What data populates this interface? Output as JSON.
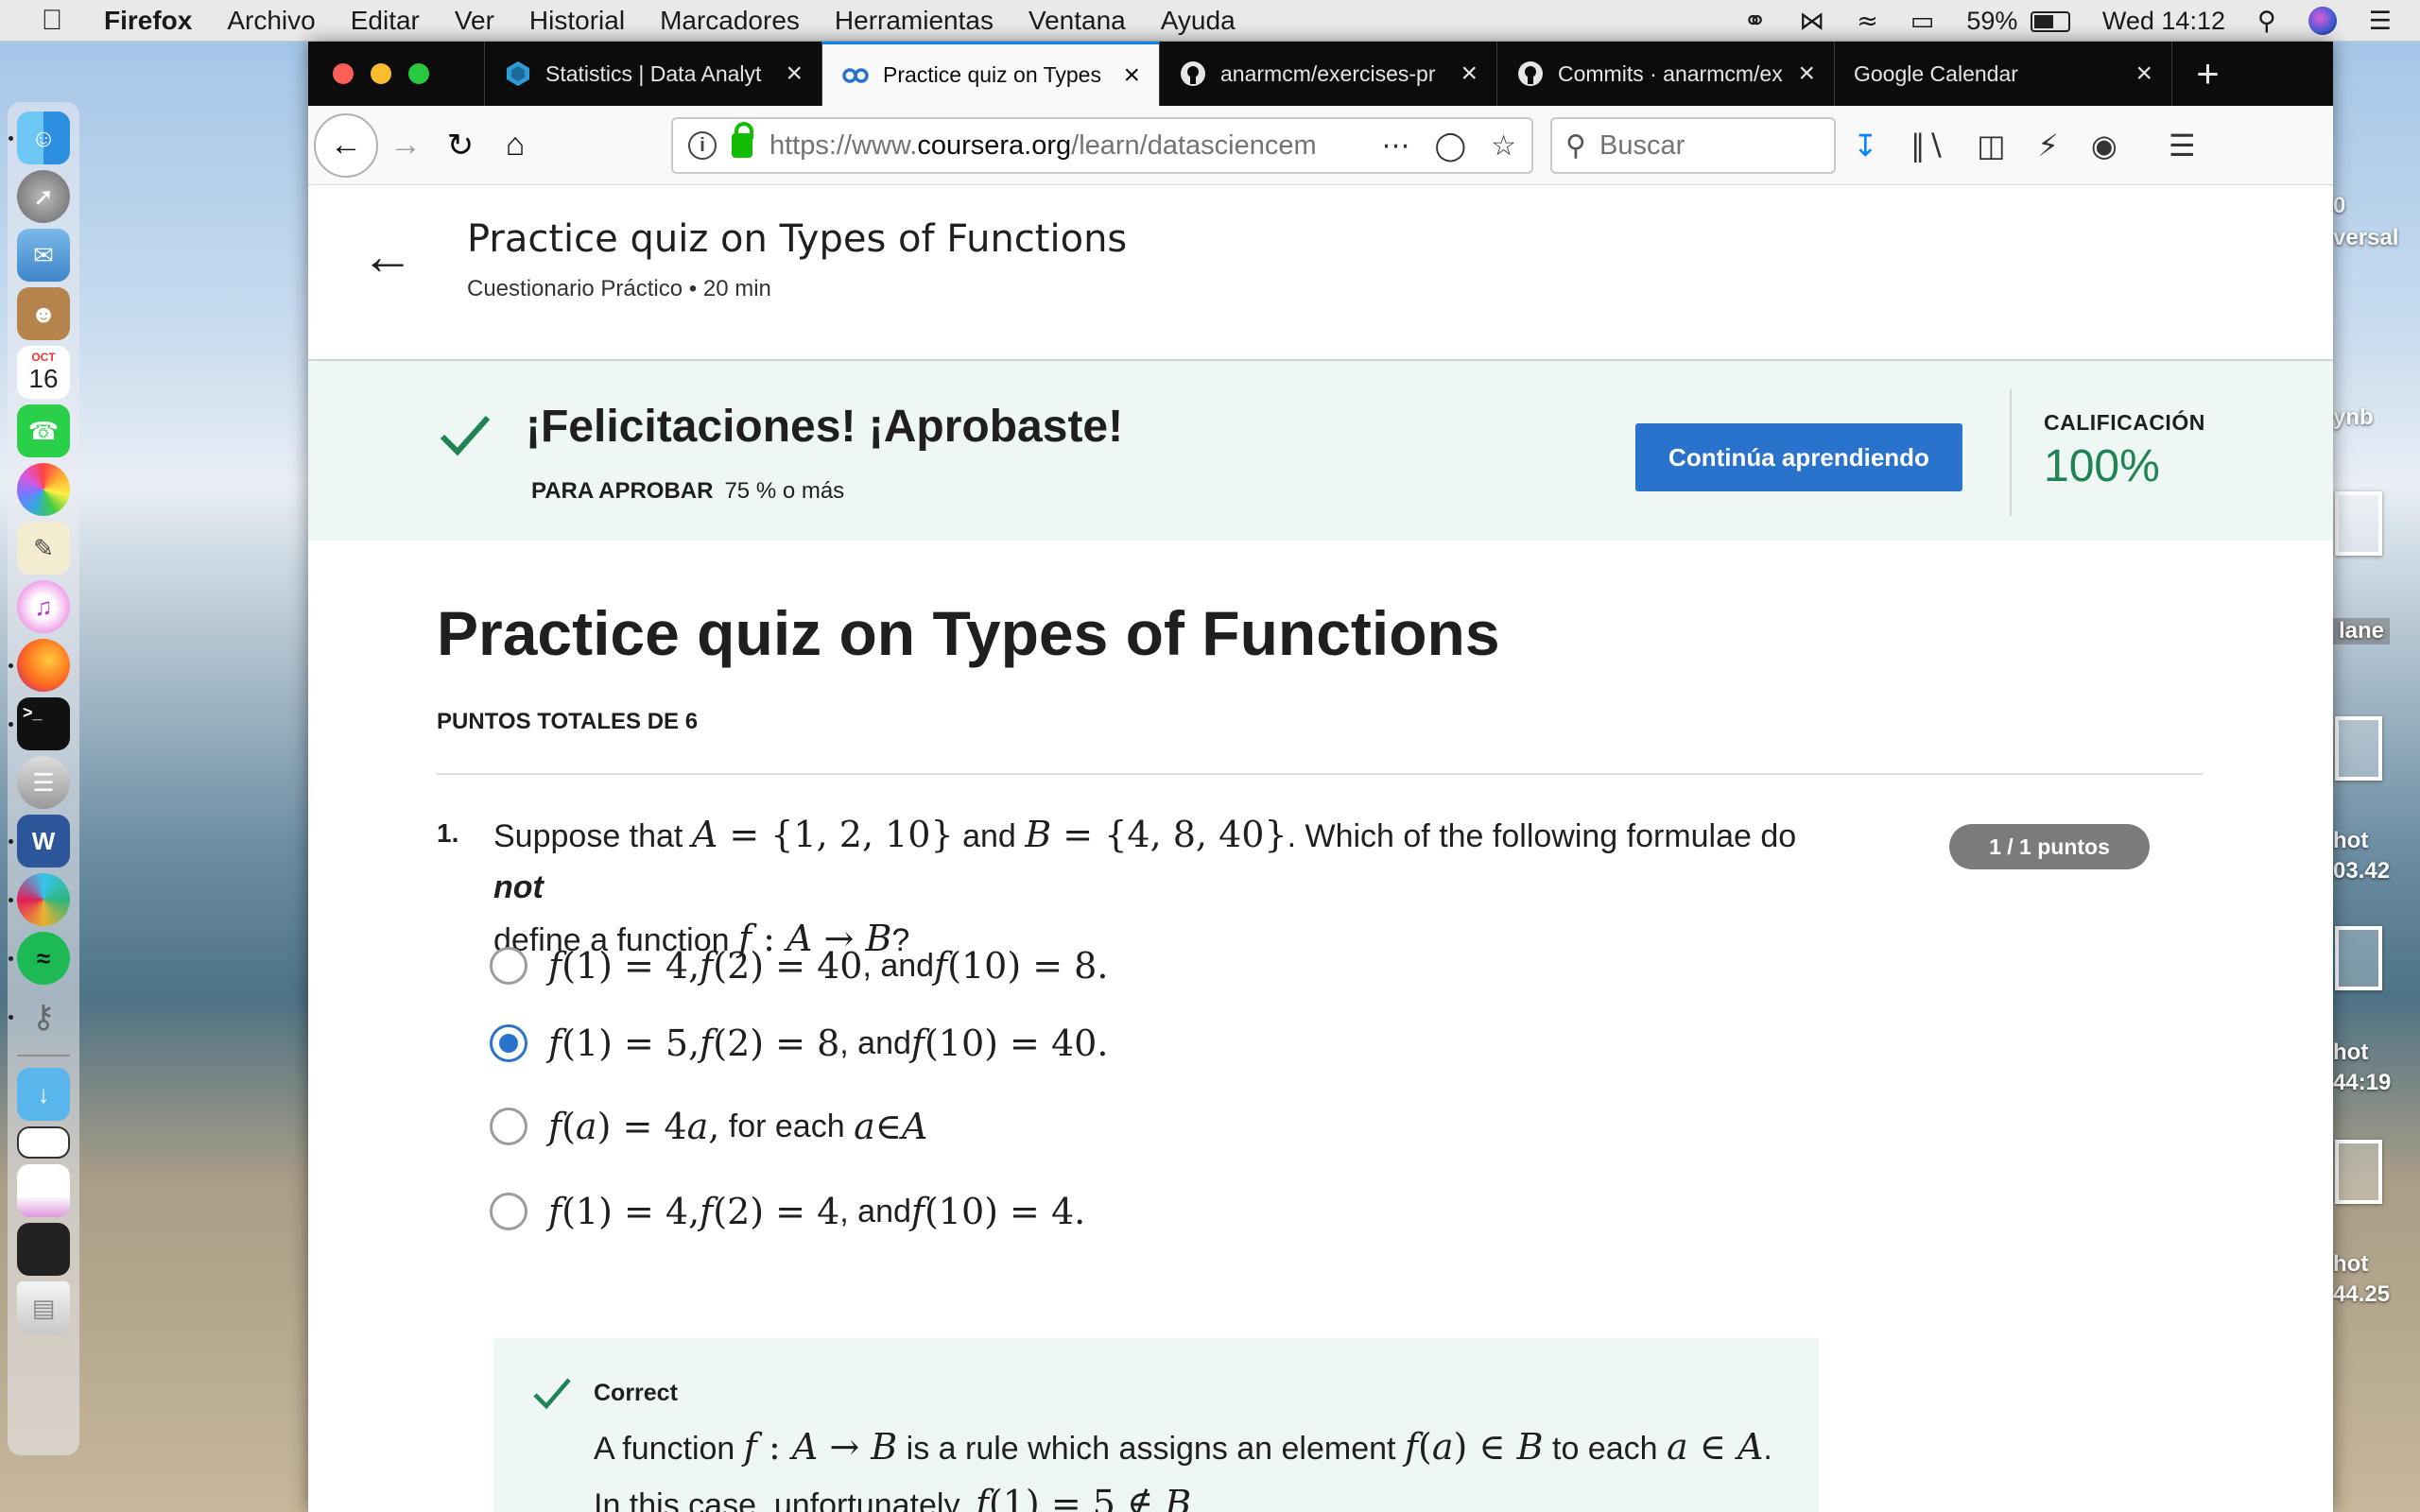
{
  "menubar": {
    "items": [
      "Firefox",
      "Archivo",
      "Editar",
      "Ver",
      "Historial",
      "Marcadores",
      "Herramientas",
      "Ventana",
      "Ayuda"
    ],
    "battery": "59%",
    "battery_fraction": 0.59,
    "clock": "Wed 14:12"
  },
  "desktop": {
    "labels": [
      "0",
      "versal",
      "ynb",
      "lane",
      "hot",
      "03.42",
      "hot",
      "44:19",
      "hot",
      "44.25"
    ]
  },
  "dock": {
    "calendar_month": "OCT",
    "calendar_day": "16",
    "word_letter": "W"
  },
  "browser": {
    "tabs": [
      {
        "title": "Statistics | Data Analyt",
        "active": false
      },
      {
        "title": "Practice quiz on Types",
        "active": true
      },
      {
        "title": "anarmcm/exercises-pr",
        "active": false
      },
      {
        "title": "Commits · anarmcm/ex",
        "active": false
      },
      {
        "title": "Google Calendar",
        "active": false
      }
    ],
    "url_prefix": "https://www.",
    "url_host": "coursera.org",
    "url_path": "/learn/datasciencem",
    "search_placeholder": "Buscar"
  },
  "page": {
    "header_title": "Practice quiz on Types of Functions",
    "header_meta": "Cuestionario Práctico • 20 min",
    "congrats": "¡Felicitaciones! ¡Aprobaste!",
    "pass_label": "PARA APROBAR",
    "pass_value": "75 % o más",
    "continue_button": "Continúa aprendiendo",
    "grade_label": "CALIFICACIÓN",
    "grade_value": "100%",
    "quiz_title": "Practice quiz on Types of Functions",
    "total_points": "PUNTOS TOTALES DE 6"
  },
  "question": {
    "number": "1.",
    "points": "1 / 1 puntos",
    "t1": "Suppose that ",
    "m1": "A",
    "m1b": " = {1, 2, 10}",
    "t2": " and ",
    "m2": "B",
    "m2b": " = {4, 8, 40}",
    "t3": ". Which of the following formulae do ",
    "t3_em": "not",
    "t4": "define a function ",
    "m4": "f",
    "m4b": " : ",
    "m4c": "A",
    "m4d": " → ",
    "m4e": "B",
    "t5": "?",
    "options": [
      {
        "a": "f",
        "b": "(1) = 4, ",
        "c": "f",
        "d": "(2) = 40",
        "e": ", and ",
        "f": "f",
        "g": "(10) = 8",
        "h": ".",
        "checked": false
      },
      {
        "a": "f",
        "b": "(1) = 5, ",
        "c": "f",
        "d": "(2) = 8",
        "e": ", and ",
        "f": "f",
        "g": "(10) = 40",
        "h": ".",
        "checked": true
      },
      {
        "a": "f",
        "b": "(",
        "c": "a",
        "d": ") = 4",
        "e": "a",
        "f": ",",
        "g": " for each ",
        "h": "a",
        "i": " ∈ ",
        "j": "A",
        "checked": false
      },
      {
        "a": "f",
        "b": "(1) = 4, ",
        "c": "f",
        "d": "(2) = 4",
        "e": ", and ",
        "f": "f",
        "g": "(10) = 4",
        "h": ".",
        "checked": false
      }
    ]
  },
  "feedback": {
    "head": "Correct",
    "t1": "A function ",
    "m1": "f",
    "m1b": " : ",
    "m1c": "A",
    "m1d": " → ",
    "m1e": "B",
    "t2": " is a rule which assigns an element ",
    "m2": "f",
    "m2b": "(",
    "m2c": "a",
    "m2d": ") ∈ ",
    "m2e": "B",
    "t3": " to each ",
    "m3": "a",
    "m3b": " ∈ ",
    "m3c": "A",
    "t4": ". In this case, unfortunately, ",
    "m4": "f",
    "m4b": "(1) = 5 ∉ ",
    "m4c": "B",
    "t5": "."
  },
  "colors": {
    "accent_blue": "#2a73cc",
    "success_green": "#1f8354",
    "banner_bg": "#eef7f4",
    "firefox_focus": "#0a84ff"
  }
}
